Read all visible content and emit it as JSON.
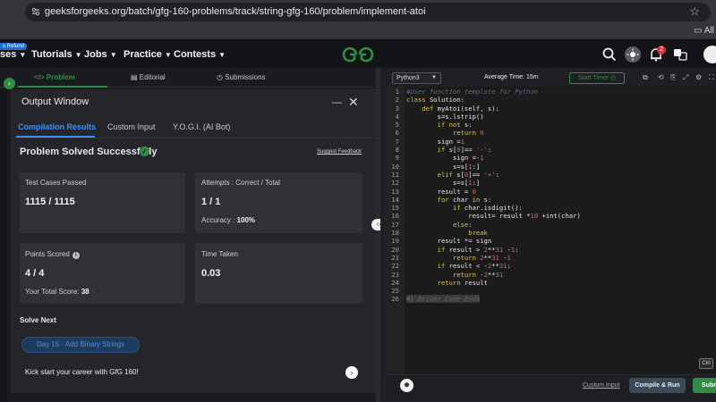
{
  "browser": {
    "url": "geeksforgeeks.org/batch/gfg-160-problems/track/string-gfg-160/problem/implement-atoi",
    "bookmarks_label": "All B"
  },
  "site_nav": {
    "refund_badge": "s Refund",
    "items": [
      "ses",
      "Tutorials",
      "Jobs",
      "Practice",
      "Contests"
    ],
    "notification_count": "2"
  },
  "problem_tabs": {
    "problem": "</> Problem",
    "editorial": "Editorial",
    "submissions": "Submissions"
  },
  "output_window": {
    "title": "Output Window",
    "tabs": [
      "Compilation Results",
      "Custom Input",
      "Y.O.G.I. (AI Bot)"
    ],
    "status": "Problem Solved Successfully",
    "suggest_feedback": "Suggest Feedback",
    "test_cases_label": "Test Cases Passed",
    "test_cases_value": "1115 / 1115",
    "attempts_label": "Attempts : Correct / Total",
    "attempts_value": "1 / 1",
    "accuracy_label": "Accuracy :",
    "accuracy_value": "100%",
    "points_label": "Points Scored",
    "points_value": "4 / 4",
    "total_score_label": "Your Total Score:",
    "total_score_value": "38",
    "time_label": "Time Taken",
    "time_value": "0.03",
    "solve_next": "Solve Next",
    "next_problem": "Day 15 - Add Binary Strings",
    "kickstart": "Kick start your career with GfG 160!"
  },
  "editor": {
    "language": "Python3",
    "average_time": "Average Time: 15m",
    "start_timer": "Start Timer",
    "ctrl_chip": "Ctrl",
    "code_lines": [
      "#User function template for Python",
      "class Solution:",
      "    def myAtoi(self, s):",
      "        s=s.lstrip()",
      "        if not s:",
      "            return 0",
      "        sign =1",
      "        if s[0]== '-':",
      "            sign =-1",
      "            s=s[1:]",
      "        elif s[0]== '+':",
      "            s=s[1:]",
      "        result = 0",
      "        for char in s:",
      "            if char.isdigit():",
      "                result= result *10 +int(char)",
      "            else:",
      "                break",
      "        result *= sign",
      "        if result > 2**31 -1:",
      "            return 2**31 -1",
      "        if result < -2**31:",
      "            return -2**31",
      "        return result",
      "",
      "#} Driver Code Ends"
    ]
  },
  "bottom_bar": {
    "custom_input": "Custom Input",
    "compile_run": "Compile & Run",
    "submit": "Submit"
  }
}
